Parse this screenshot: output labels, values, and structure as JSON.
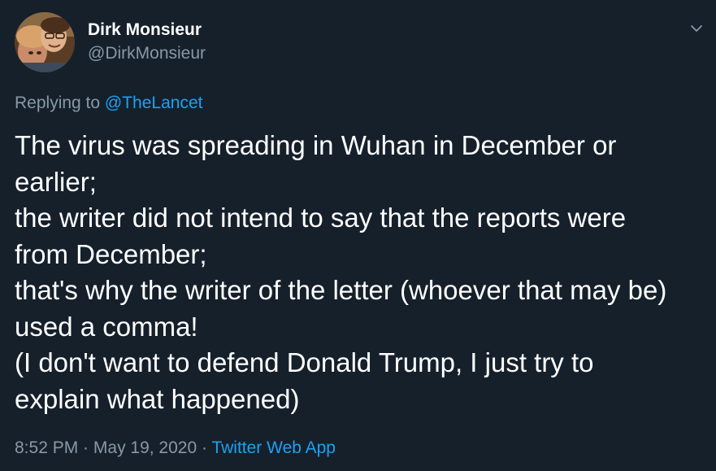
{
  "author": {
    "display_name": "Dirk Monsieur",
    "handle": "@DirkMonsieur"
  },
  "reply_context": {
    "prefix": "Replying to ",
    "mention": "@TheLancet"
  },
  "tweet": {
    "lines": [
      "The virus was spreading in Wuhan in December or",
      "earlier;",
      "the writer did not intend to say that the reports were",
      "from December;",
      "that's why the writer of the letter (whoever that may be)",
      "used a comma!",
      "(I don't want to defend Donald Trump, I just try to",
      "explain what happened)"
    ]
  },
  "meta": {
    "time": "8:52 PM",
    "separator": " · ",
    "date": "May 19, 2020",
    "source": "Twitter Web App"
  },
  "icons": {
    "caret": "chevron-down-icon",
    "avatar": "avatar-photo"
  },
  "colors": {
    "background": "#15202b",
    "text": "#ffffff",
    "secondary_text": "#8899a6",
    "accent": "#1da1f2"
  }
}
